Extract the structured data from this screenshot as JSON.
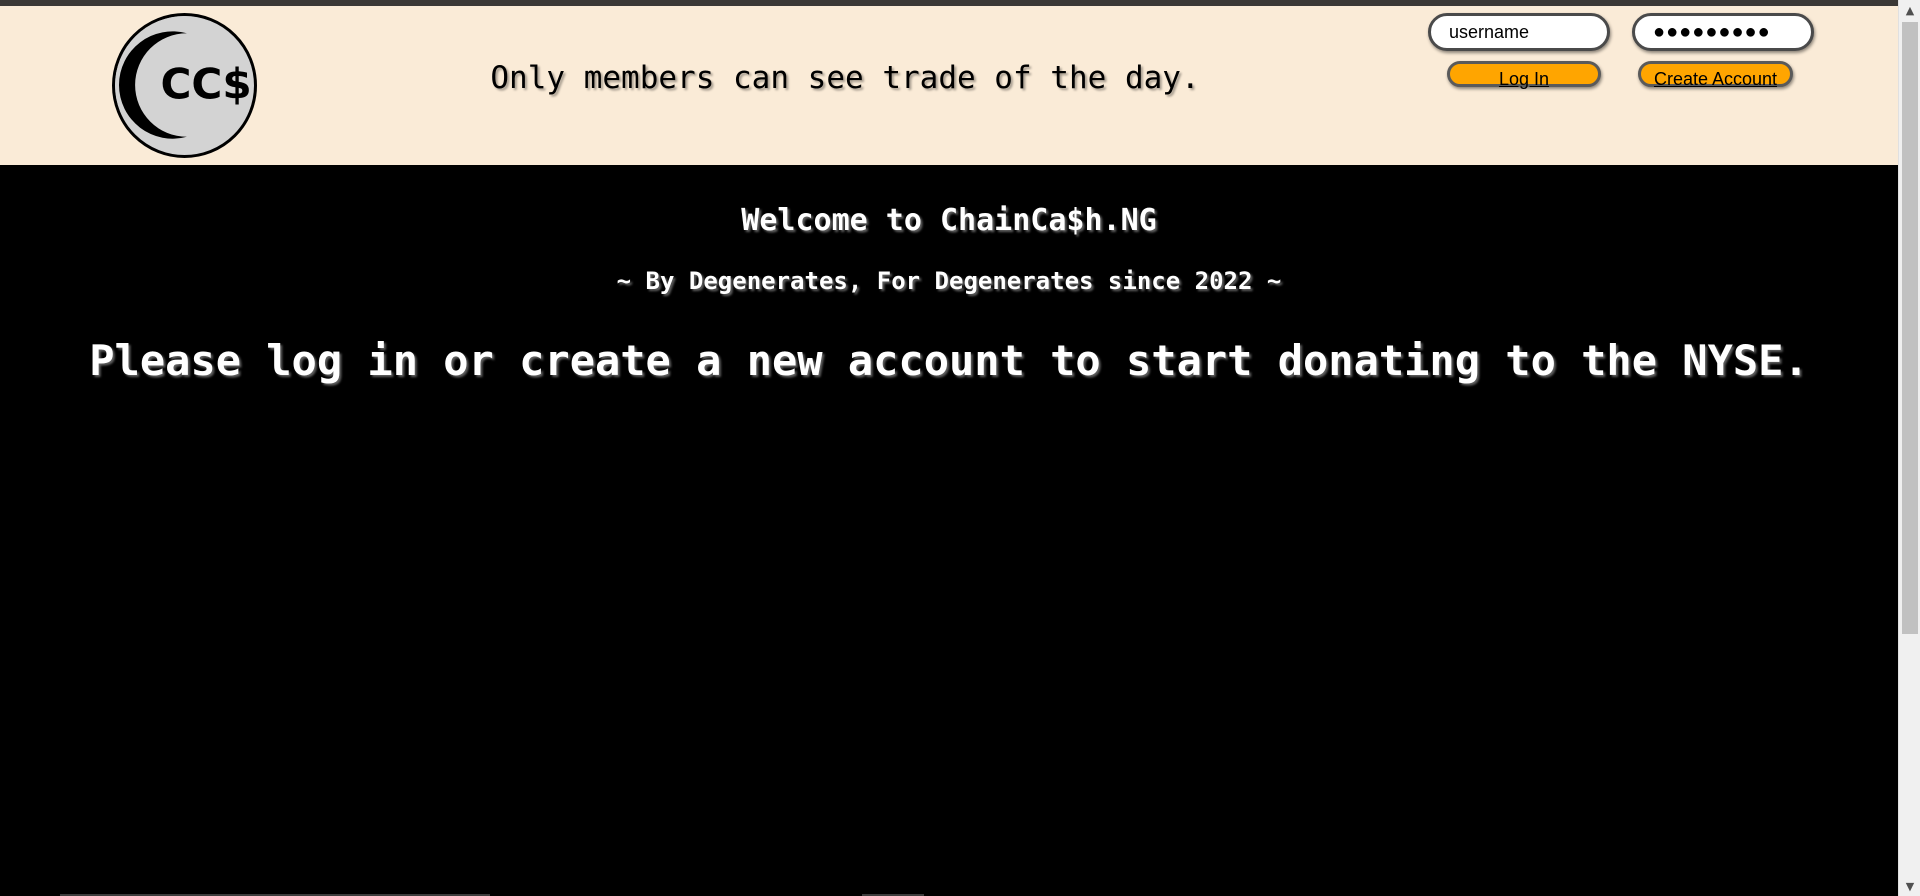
{
  "header": {
    "logo_text": "CC$",
    "tagline": "Only members can see trade of the day.",
    "username_value": "username",
    "password_value": "●●●●●●●●●",
    "login_label": "Log In",
    "create_account_label": "Create Account"
  },
  "main": {
    "welcome": "Welcome to ChainCa$h.NG",
    "subtitle": "~ By Degenerates, For Degenerates since 2022 ~",
    "cta": "Please log in or create a new account to start donating to the NYSE."
  },
  "scrollbar": {
    "up_icon": "chevron-up-icon",
    "down_icon": "chevron-down-icon"
  },
  "colors": {
    "header_bg": "#faebd7",
    "page_bg": "#000000",
    "button_bg": "#ffa500",
    "logo_bg": "#d3d3d3"
  }
}
